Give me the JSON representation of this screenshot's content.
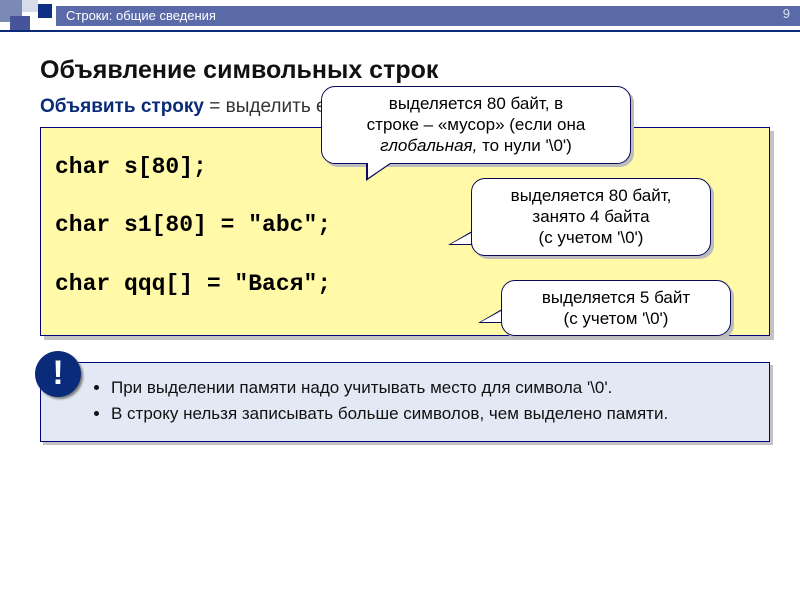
{
  "header": {
    "breadcrumb": "Строки: общие сведения",
    "page_number": "9"
  },
  "title": "Объявление символьных строк",
  "lead": {
    "term": "Объявить строку",
    "rest": " = выделить ей место в памяти и присвоить имя."
  },
  "code": {
    "line1": "char s[80];",
    "line2": "char s1[80] = \"abc\";",
    "line3": "char qqq[] = \"Вася\";"
  },
  "callouts": {
    "c1_a": "выделяется 80 байт, в",
    "c1_b": "строке – «мусор» (если она",
    "c1_c_i": "глобальная,",
    "c1_c": " то нули '\\0')",
    "c2_a": "выделяется 80 байт,",
    "c2_b": "занято 4 байта",
    "c2_c": "(с учетом '\\0')",
    "c3_a": "выделяется 5 байт",
    "c3_b": "(с учетом '\\0')"
  },
  "note": {
    "bang": "!",
    "li1": "При выделении памяти надо учитывать место для символа '\\0'.",
    "li2": "В строку нельзя записывать больше символов, чем выделено памяти."
  }
}
